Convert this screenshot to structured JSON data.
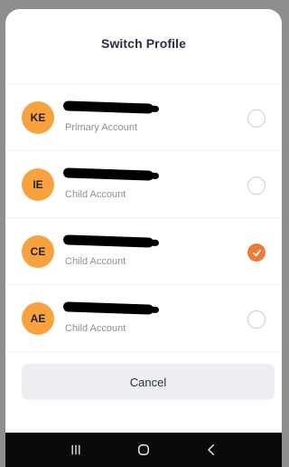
{
  "sheet": {
    "title": "Switch Profile"
  },
  "profiles": [
    {
      "initials": "KE",
      "account_type": "Primary Account",
      "selected": false
    },
    {
      "initials": "IE",
      "account_type": "Child Account",
      "selected": false
    },
    {
      "initials": "CE",
      "account_type": "Child Account",
      "selected": true
    },
    {
      "initials": "AE",
      "account_type": "Child Account",
      "selected": false
    }
  ],
  "actions": {
    "cancel_label": "Cancel"
  },
  "nav": {
    "icons": [
      "recent-apps-icon",
      "home-icon",
      "back-icon"
    ]
  },
  "colors": {
    "avatar": "#f7a23f",
    "selected_radio": "#f07a3a",
    "nav_bar": "#0a0a0a"
  }
}
